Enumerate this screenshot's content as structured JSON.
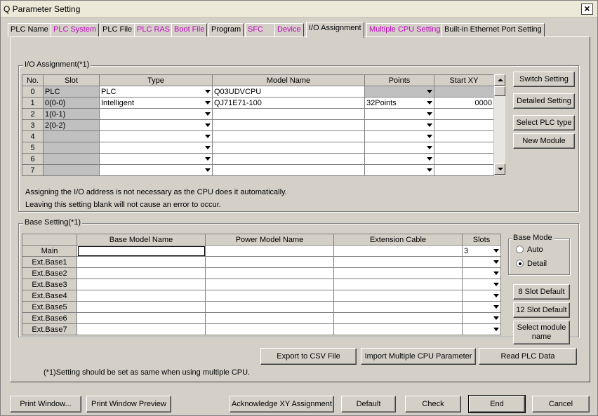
{
  "window": {
    "title": "Q Parameter Setting",
    "close_glyph": "×"
  },
  "tabs": [
    {
      "label": "PLC Name"
    },
    {
      "label": "PLC System"
    },
    {
      "label": "PLC File"
    },
    {
      "label": "PLC RAS"
    },
    {
      "label": "Boot File"
    },
    {
      "label": "Program"
    },
    {
      "label": "SFC"
    },
    {
      "label": "Device"
    },
    {
      "label": "I/O Assignment"
    },
    {
      "label": "Multiple CPU Setting"
    },
    {
      "label": "Built-in Ethernet Port Setting"
    }
  ],
  "io": {
    "group_label": "I/O Assignment(*1)",
    "headers": {
      "no": "No.",
      "slot": "Slot",
      "type": "Type",
      "model": "Model Name",
      "points": "Points",
      "start": "Start XY"
    },
    "rows": [
      {
        "no": "0",
        "slot": "PLC",
        "type": "PLC",
        "model": "Q03UDVCPU",
        "points": "",
        "start": ""
      },
      {
        "no": "1",
        "slot": "0(0-0)",
        "type": "Intelligent",
        "model": "QJ71E71-100",
        "points": "32Points",
        "start": "0000"
      },
      {
        "no": "2",
        "slot": "1(0-1)",
        "type": "",
        "model": "",
        "points": "",
        "start": ""
      },
      {
        "no": "3",
        "slot": "2(0-2)",
        "type": "",
        "model": "",
        "points": "",
        "start": ""
      },
      {
        "no": "4",
        "slot": "",
        "type": "",
        "model": "",
        "points": "",
        "start": ""
      },
      {
        "no": "5",
        "slot": "",
        "type": "",
        "model": "",
        "points": "",
        "start": ""
      },
      {
        "no": "6",
        "slot": "",
        "type": "",
        "model": "",
        "points": "",
        "start": ""
      },
      {
        "no": "7",
        "slot": "",
        "type": "",
        "model": "",
        "points": "",
        "start": ""
      }
    ],
    "buttons": {
      "switch": "Switch Setting",
      "detailed": "Detailed Setting",
      "select_plc": "Select PLC type",
      "new_module": "New Module"
    },
    "note1": "Assigning the I/O address is not necessary as the CPU does it automatically.",
    "note2": "Leaving this setting blank will not cause an error to occur."
  },
  "base": {
    "group_label": "Base Setting(*1)",
    "headers": {
      "base_model": "Base Model Name",
      "power_model": "Power Model Name",
      "ext_cable": "Extension Cable",
      "slots": "Slots"
    },
    "rows": [
      {
        "name": "Main",
        "slots": "3"
      },
      {
        "name": "Ext.Base1",
        "slots": ""
      },
      {
        "name": "Ext.Base2",
        "slots": ""
      },
      {
        "name": "Ext.Base3",
        "slots": ""
      },
      {
        "name": "Ext.Base4",
        "slots": ""
      },
      {
        "name": "Ext.Base5",
        "slots": ""
      },
      {
        "name": "Ext.Base6",
        "slots": ""
      },
      {
        "name": "Ext.Base7",
        "slots": ""
      }
    ],
    "mode": {
      "label": "Base Mode",
      "auto": "Auto",
      "detail": "Detail",
      "selected": "Detail"
    },
    "buttons": {
      "slot8": "8 Slot Default",
      "slot12": "12 Slot Default",
      "select_module": "Select module name"
    }
  },
  "panel_buttons": {
    "export_csv": "Export to CSV File",
    "import_multi": "Import Multiple CPU Parameter",
    "read_plc": "Read PLC Data"
  },
  "footnote": "(*1)Setting should be set as same when using multiple CPU.",
  "bottom_buttons": {
    "print": "Print Window...",
    "print_preview": "Print Window Preview",
    "ack_xy": "Acknowledge XY Assignment",
    "default": "Default",
    "check": "Check",
    "end": "End",
    "cancel": "Cancel"
  }
}
